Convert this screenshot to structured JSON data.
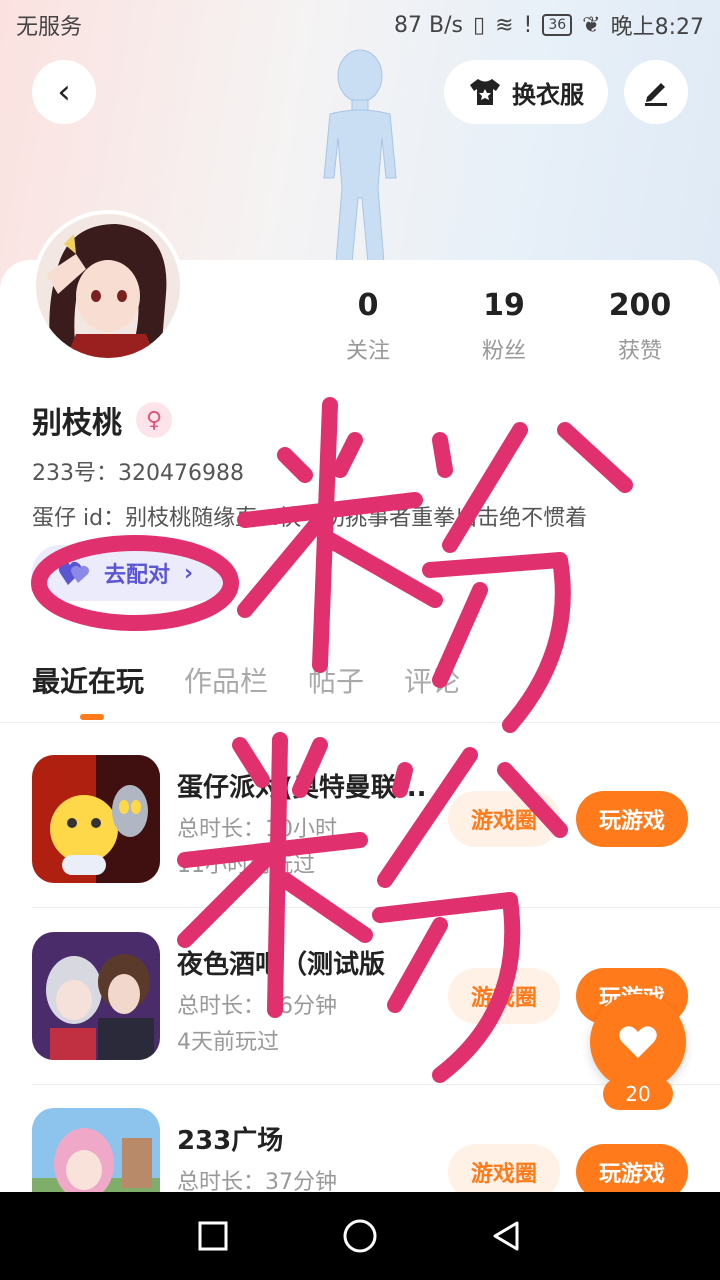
{
  "status": {
    "carrier": "无服务",
    "speed": "87 B/s",
    "battery": "36",
    "time": "晚上8:27"
  },
  "header": {
    "outfit_label": "换衣服"
  },
  "profile": {
    "name": "别枝桃",
    "gender_symbol": "♀",
    "id_line": "233号：320476988",
    "egg_line": "蛋仔 id：别枝桃随缘直…快一切挑事者重拳出击绝不惯着",
    "pair_label": "去配对",
    "stats": [
      {
        "num": "0",
        "label": "关注"
      },
      {
        "num": "19",
        "label": "粉丝"
      },
      {
        "num": "200",
        "label": "获赞"
      }
    ]
  },
  "tabs": [
    "最近在玩",
    "作品栏",
    "帖子",
    "评论"
  ],
  "games": [
    {
      "title": "蛋仔派对(奥特曼联...",
      "duration": "总时长：10小时",
      "last_played": "11小时前玩过",
      "circle_label": "游戏圈",
      "play_label": "玩游戏"
    },
    {
      "title": "夜色酒吧（测试版",
      "duration": "总时长：16分钟",
      "last_played": "4天前玩过",
      "circle_label": "游戏圈",
      "play_label": "玩游戏"
    },
    {
      "title": "233广场",
      "duration": "总时长：37分钟",
      "last_played": "",
      "circle_label": "游戏圈",
      "play_label": "玩游戏"
    }
  ],
  "fab": {
    "count": "20"
  },
  "colors": {
    "accent": "#ff7a1a",
    "scribble": "#e0306e",
    "pair": "#5a55d2"
  }
}
